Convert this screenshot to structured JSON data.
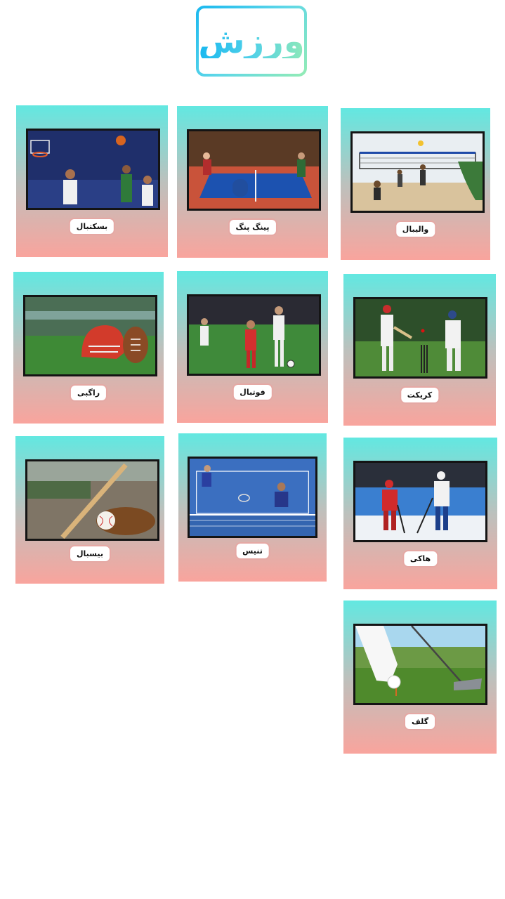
{
  "title": "ورزش",
  "cards": [
    {
      "label": "والیبال",
      "icon": "volleyball-photo"
    },
    {
      "label": "پینگ پنگ",
      "icon": "table-tennis-photo"
    },
    {
      "label": "بسکتبال",
      "icon": "basketball-photo"
    },
    {
      "label": "کریکت",
      "icon": "cricket-photo"
    },
    {
      "label": "فوتبال",
      "icon": "football-photo"
    },
    {
      "label": "راگبی",
      "icon": "rugby-photo"
    },
    {
      "label": "هاکی",
      "icon": "hockey-photo"
    },
    {
      "label": "تنیس",
      "icon": "tennis-photo"
    },
    {
      "label": "بیسبال",
      "icon": "baseball-photo"
    },
    {
      "label": "گلف",
      "icon": "golf-photo"
    }
  ],
  "colors": {
    "card_top": "#62e8e1",
    "card_bottom": "#f9a49d",
    "title_start": "#19b8f0",
    "title_end": "#95ecb4"
  }
}
